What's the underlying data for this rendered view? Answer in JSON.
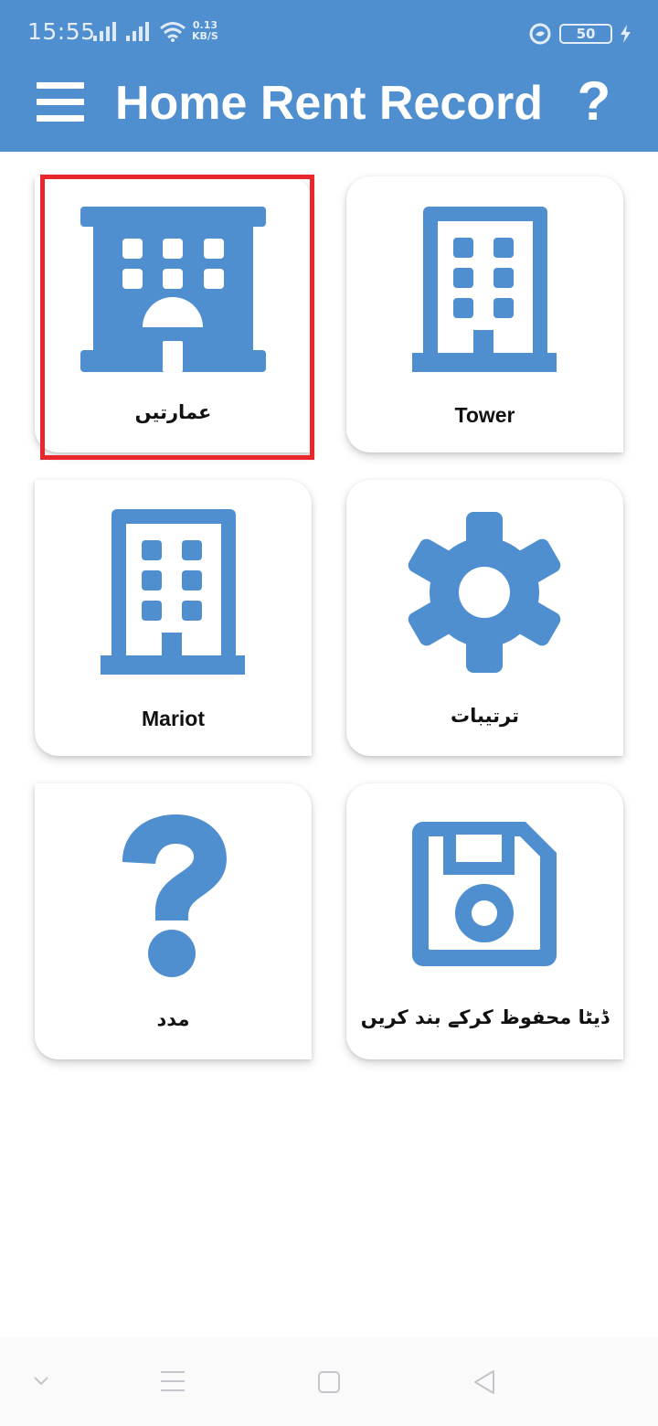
{
  "status_bar": {
    "time": "15:55",
    "net_speed_value": "0.13",
    "net_speed_unit": "KB/S",
    "battery": "50"
  },
  "toolbar": {
    "title": "Home Rent Record",
    "help_label": "?"
  },
  "tiles": [
    {
      "label": "عمارتیں",
      "icon": "apartment-building-icon"
    },
    {
      "label": "Tower",
      "icon": "tower-building-icon"
    },
    {
      "label": "Mariot",
      "icon": "office-building-icon"
    },
    {
      "label": "ترتیبات",
      "icon": "gear-icon"
    },
    {
      "label": "مدد",
      "icon": "question-mark-icon"
    },
    {
      "label": "ڈیٹا محفوظ کرکے بند کریں",
      "icon": "floppy-disk-icon"
    }
  ],
  "colors": {
    "primary": "#4f8fcf",
    "icon": "#4f8fcf",
    "highlight": "#e8262b"
  }
}
